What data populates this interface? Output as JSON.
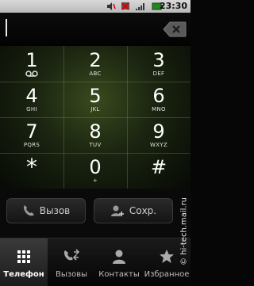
{
  "status_bar": {
    "time": "23:30",
    "icons": [
      "mute-icon",
      "no-signal-icon",
      "signal-icon",
      "battery-icon"
    ]
  },
  "dialer": {
    "number": "",
    "keys": [
      {
        "digit": "1",
        "letters": ""
      },
      {
        "digit": "2",
        "letters": "ABC"
      },
      {
        "digit": "3",
        "letters": "DEF"
      },
      {
        "digit": "4",
        "letters": "GHI"
      },
      {
        "digit": "5",
        "letters": "JKL"
      },
      {
        "digit": "6",
        "letters": "MNO"
      },
      {
        "digit": "7",
        "letters": "PQRS"
      },
      {
        "digit": "8",
        "letters": "TUV"
      },
      {
        "digit": "9",
        "letters": "WXYZ"
      },
      {
        "digit": "*",
        "letters": ""
      },
      {
        "digit": "0",
        "letters": "+"
      },
      {
        "digit": "#",
        "letters": ""
      }
    ]
  },
  "actions": {
    "call_label": "Вызов",
    "save_label": "Сохр."
  },
  "tabs": [
    {
      "label": "Телефон",
      "icon": "dialpad-icon",
      "active": true
    },
    {
      "label": "Вызовы",
      "icon": "call-log-icon",
      "active": false
    },
    {
      "label": "Контакты",
      "icon": "contacts-icon",
      "active": false
    },
    {
      "label": "Избранное",
      "icon": "star-icon",
      "active": false
    }
  ],
  "watermark": "© hi-tech.mail.ru",
  "colors": {
    "keypad_glow": "#3a4a1e",
    "background": "#050605"
  }
}
